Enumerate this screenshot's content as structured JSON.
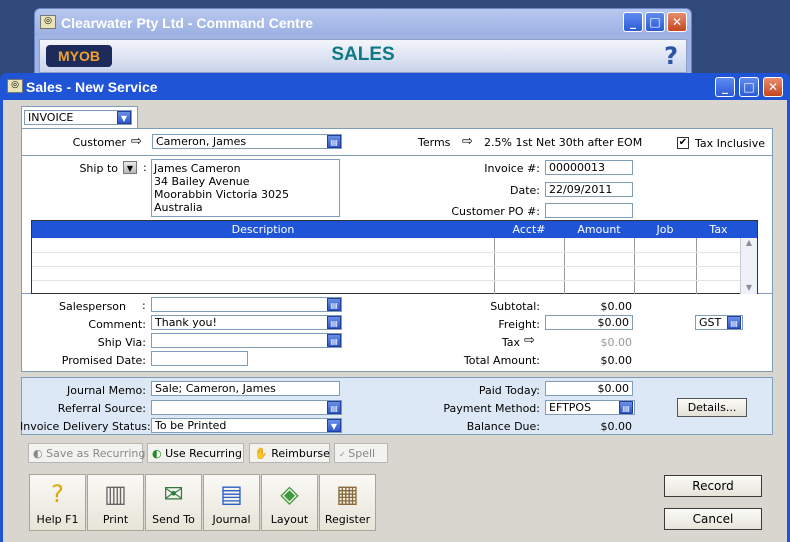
{
  "command_centre": {
    "title": "Clearwater Pty Ltd - Command Centre",
    "logo": "MYOB",
    "section": "SALES",
    "help_glyph": "?"
  },
  "window": {
    "title": "Sales - New Service"
  },
  "window_controls": {
    "minimize": "_",
    "maximize": "□",
    "close": "✕"
  },
  "form_type": {
    "value": "INVOICE"
  },
  "customer": {
    "label": "Customer",
    "arrow": "⇨",
    "value": "Cameron, James"
  },
  "terms": {
    "label": "Terms",
    "arrow": "⇨",
    "value": "2.5% 1st Net 30th after EOM"
  },
  "tax_inclusive": {
    "label": "Tax Inclusive",
    "checked": true,
    "mark": "✔"
  },
  "ship_to": {
    "label": "Ship to",
    "lines": [
      "James Cameron",
      "34 Bailey Avenue",
      "Moorabbin  Victoria  3025",
      "Australia"
    ]
  },
  "invoice": {
    "number_label": "Invoice #:",
    "number": "00000013",
    "date_label": "Date:",
    "date": "22/09/2011",
    "po_label": "Customer PO #:",
    "po": ""
  },
  "grid": {
    "columns": [
      "Description",
      "Acct#",
      "Amount",
      "Job",
      "Tax"
    ]
  },
  "details": {
    "salesperson_label": "Salesperson",
    "salesperson": "",
    "comment_label": "Comment:",
    "comment": "Thank you!",
    "ship_via_label": "Ship Via:",
    "ship_via": "",
    "promised_date_label": "Promised Date:",
    "promised_date": ""
  },
  "totals": {
    "subtotal_label": "Subtotal:",
    "subtotal": "$0.00",
    "freight_label": "Freight:",
    "freight": "$0.00",
    "tax_label": "Tax",
    "tax": "$0.00",
    "total_label": "Total Amount:",
    "total": "$0.00",
    "freight_tax_code": "GST"
  },
  "payment": {
    "journal_memo_label": "Journal Memo:",
    "journal_memo": "Sale; Cameron, James",
    "referral_label": "Referral Source:",
    "referral": "",
    "delivery_label": "Invoice Delivery Status:",
    "delivery": "To be Printed",
    "paid_today_label": "Paid Today:",
    "paid_today": "$0.00",
    "method_label": "Payment Method:",
    "method": "EFTPOS",
    "balance_label": "Balance Due:",
    "balance": "$0.00",
    "details_button": "Details..."
  },
  "toolbar": {
    "save_recurring": "Save as Recurring",
    "use_recurring": "Use Recurring",
    "reimburse": "Reimburse",
    "spell": "Spell"
  },
  "big_buttons": {
    "help": "Help F1",
    "print": "Print",
    "send_to": "Send To",
    "journal": "Journal",
    "layout": "Layout",
    "register": "Register"
  },
  "actions": {
    "record": "Record",
    "cancel": "Cancel"
  }
}
